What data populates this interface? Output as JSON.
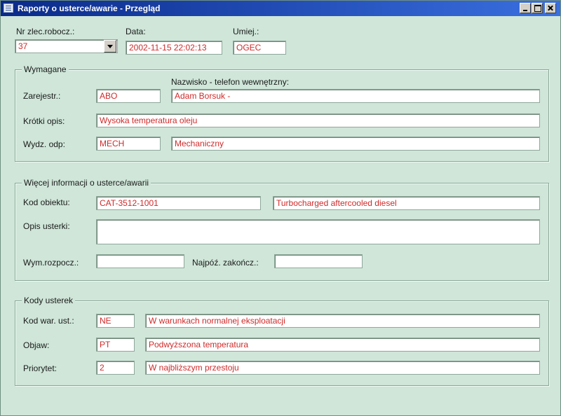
{
  "window": {
    "title": "Raporty o usterce/awarie - Przegląd"
  },
  "header": {
    "order_label": "Nr zlec.robocz.:",
    "order_value": "37",
    "date_label": "Data:",
    "date_value": "2002-11-15 22:02:13",
    "skill_label": "Umiej.:",
    "skill_value": "OGEC"
  },
  "requirement": {
    "legend": "Wymagane",
    "name_phone_label": "Nazwisko - telefon wewnętrzny:",
    "registered_label": "Zarejestr.:",
    "registered_code": "ABO",
    "registered_name": "Adam Borsuk -",
    "short_desc_label": "Krótki opis:",
    "short_desc_value": "Wysoka temperatura oleju",
    "dept_label": "Wydz. odp:",
    "dept_code": "MECH",
    "dept_name": "Mechaniczny"
  },
  "more_info": {
    "legend": "Więcej informacji o usterce/awarii",
    "object_label": "Kod obiektu:",
    "object_code": "CAT-3512-1001",
    "object_desc": "Turbocharged aftercooled diesel",
    "fault_desc_label": "Opis usterki:",
    "fault_desc_value": "",
    "req_start_label": "Wym.rozpocz.:",
    "req_start_value": "",
    "latest_end_label": "Najpóź. zakończ.:",
    "latest_end_value": ""
  },
  "fault_codes": {
    "legend": "Kody usterek",
    "cond_label": "Kod war. ust.:",
    "cond_code": "NE",
    "cond_desc": "W warunkach normalnej eksploatacji",
    "symptom_label": "Objaw:",
    "symptom_code": "PT",
    "symptom_desc": "Podwyższona temperatura",
    "priority_label": "Priorytet:",
    "priority_code": "2",
    "priority_desc": "W najbliższym przestoju"
  },
  "colors": {
    "background": "#cfe6d9",
    "field_text": "#d02a2a",
    "titlebar": "#0a2a8a"
  }
}
